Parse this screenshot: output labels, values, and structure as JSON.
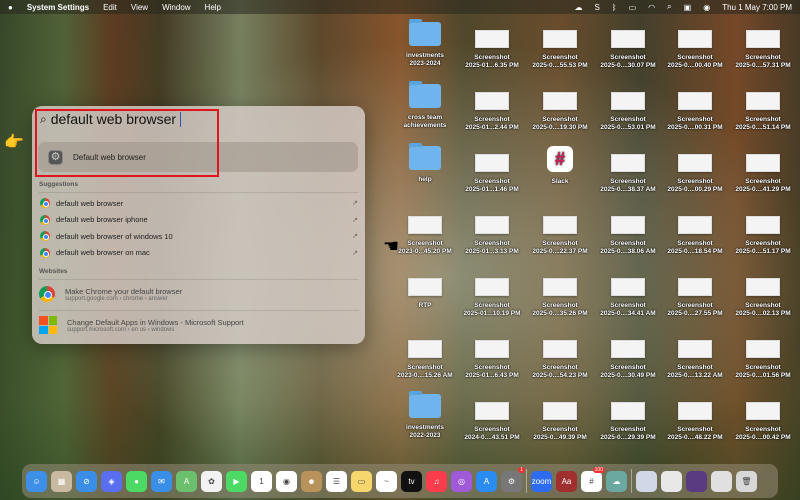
{
  "menubar": {
    "app": "System Settings",
    "items": [
      "Edit",
      "View",
      "Window",
      "Help"
    ],
    "status_icons": [
      "creative-cloud-icon",
      "s-icon",
      "bluetooth-icon",
      "battery-icon",
      "wifi-icon",
      "search-icon",
      "control-center-icon",
      "siri-icon"
    ],
    "clock": "Thu 1 May  7:00 PM"
  },
  "spotlight": {
    "query": "default web browser",
    "top_hit": "Default web browser",
    "suggestions_label": "Suggestions",
    "suggestions": [
      "default web browser",
      "default web browser iphone",
      "default web browser of windows 10",
      "default web browser on mac"
    ],
    "websites_label": "Websites",
    "websites": [
      {
        "title": "Make Chrome your default browser",
        "url": "support.google.com › chrome › answer"
      },
      {
        "title": "Change Default Apps in Windows - Microsoft Support",
        "url": "support.microsoft.com › en us › windows"
      }
    ],
    "highlight_color": "#e0141c"
  },
  "desktop": [
    [
      [
        "folder",
        "investments",
        "2023-2024"
      ],
      [
        "shot",
        "Screenshot",
        "2025-01...6.35 PM"
      ],
      [
        "shot",
        "Screenshot",
        "2025-0....55.53 PM"
      ],
      [
        "shot",
        "Screenshot",
        "2025-0....30.07 PM"
      ],
      [
        "shot",
        "Screenshot",
        "2025-0....00.40 PM"
      ],
      [
        "shot",
        "Screenshot",
        "2025-0....57.31 PM"
      ]
    ],
    [
      [
        "folder",
        "cross team",
        "achievements"
      ],
      [
        "shot",
        "Screenshot",
        "2025-01...2.44 PM"
      ],
      [
        "shot",
        "Screenshot",
        "2025-0....19.30 PM"
      ],
      [
        "shot",
        "Screenshot",
        "2025-0....53.01 PM"
      ],
      [
        "shot",
        "Screenshot",
        "2025-0....00.31 PM"
      ],
      [
        "shot",
        "Screenshot",
        "2025-0....51.14 PM"
      ]
    ],
    [
      [
        "folder",
        "help",
        ""
      ],
      [
        "shot",
        "Screenshot",
        "2025-01...1.46 PM"
      ],
      [
        "slack",
        "Slack",
        ""
      ],
      [
        "shot",
        "Screenshot",
        "2025-0....38.37 AM"
      ],
      [
        "shot",
        "Screenshot",
        "2025-0....00.29 PM"
      ],
      [
        "shot",
        "Screenshot",
        "2025-0....41.29 PM"
      ]
    ],
    [
      [
        "shot",
        "Screenshot",
        "2023-0...45.20 PM"
      ],
      [
        "shot",
        "Screenshot",
        "2025-01...3.13 PM"
      ],
      [
        "shot",
        "Screenshot",
        "2025-0....22.37 PM"
      ],
      [
        "shot",
        "Screenshot",
        "2025-0....38.06 AM"
      ],
      [
        "shot",
        "Screenshot",
        "2025-0....18.54 PM"
      ],
      [
        "shot",
        "Screenshot",
        "2025-0....51.17 PM"
      ]
    ],
    [
      [
        "shot",
        "RTP",
        ""
      ],
      [
        "shot",
        "Screenshot",
        "2025-01...10.19 PM"
      ],
      [
        "shot",
        "Screenshot",
        "2025-0....35.26 PM"
      ],
      [
        "shot",
        "Screenshot",
        "2025-0....34.41 AM"
      ],
      [
        "shot",
        "Screenshot",
        "2025-0....27.55 PM"
      ],
      [
        "shot",
        "Screenshot",
        "2025-0....02.13 PM"
      ]
    ],
    [
      [
        "shot",
        "Screenshot",
        "2023-0....15.26 AM"
      ],
      [
        "shot",
        "Screenshot",
        "2025-01...6.43 PM"
      ],
      [
        "shot",
        "Screenshot",
        "2025-0....54.23 PM"
      ],
      [
        "shot",
        "Screenshot",
        "2025-0....30.49 PM"
      ],
      [
        "shot",
        "Screenshot",
        "2025-0....13.22 AM"
      ],
      [
        "shot",
        "Screenshot",
        "2025-0....01.56 PM"
      ]
    ],
    [
      [
        "folder",
        "investments",
        "2022-2023"
      ],
      [
        "shot",
        "Screenshot",
        "2024-0....43.51 PM"
      ],
      [
        "shot",
        "Screenshot",
        "2025-0...49.39 PM"
      ],
      [
        "shot",
        "Screenshot",
        "2025-0....29.39 PM"
      ],
      [
        "shot",
        "Screenshot",
        "2025-0....48.22 PM"
      ],
      [
        "shot",
        "Screenshot",
        "2025-0....00.42 PM"
      ]
    ]
  ],
  "dock": [
    {
      "name": "finder",
      "color": "#3d8fe8",
      "glyph": "☺"
    },
    {
      "name": "launchpad",
      "color": "#c9b9a0",
      "glyph": "▦"
    },
    {
      "name": "safari",
      "color": "#3a8ee6",
      "glyph": "⊘"
    },
    {
      "name": "copilot",
      "color": "#5a6ef0",
      "glyph": "◈"
    },
    {
      "name": "messages",
      "color": "#4cd964",
      "glyph": "●"
    },
    {
      "name": "mail",
      "color": "#3a8ee6",
      "glyph": "✉"
    },
    {
      "name": "maps",
      "color": "#6cbf6c",
      "glyph": "A"
    },
    {
      "name": "photos",
      "color": "#f2f2f2",
      "glyph": "✿"
    },
    {
      "name": "facetime",
      "color": "#4cd964",
      "glyph": "▶"
    },
    {
      "name": "calendar",
      "color": "#ffffff",
      "glyph": "1"
    },
    {
      "name": "chrome",
      "color": "#ffffff",
      "glyph": "◉"
    },
    {
      "name": "contacts",
      "color": "#b8925a",
      "glyph": "☻"
    },
    {
      "name": "reminders",
      "color": "#ffffff",
      "glyph": "☰"
    },
    {
      "name": "notes",
      "color": "#f5d76e",
      "glyph": "▭"
    },
    {
      "name": "freeform",
      "color": "#ffffff",
      "glyph": "~"
    },
    {
      "name": "tv",
      "color": "#111111",
      "glyph": "tv"
    },
    {
      "name": "music",
      "color": "#fa3c4c",
      "glyph": "♫"
    },
    {
      "name": "podcasts",
      "color": "#a05ad8",
      "glyph": "◎"
    },
    {
      "name": "app-store",
      "color": "#2a8cf0",
      "glyph": "A"
    },
    {
      "name": "system-settings",
      "color": "#777777",
      "glyph": "⚙",
      "badge": "1"
    },
    {
      "sep": true
    },
    {
      "name": "zoom",
      "color": "#2d6cf0",
      "glyph": "zoom"
    },
    {
      "name": "dictionary",
      "color": "#a03030",
      "glyph": "Aa"
    },
    {
      "name": "slack",
      "color": "#ffffff",
      "glyph": "#",
      "badge": "100"
    },
    {
      "name": "cloud-app",
      "color": "#6aa8a0",
      "glyph": "☁"
    },
    {
      "sep": true
    },
    {
      "name": "window-1",
      "color": "#d0d8e8",
      "glyph": ""
    },
    {
      "name": "window-2",
      "color": "#e8e8e8",
      "glyph": ""
    },
    {
      "name": "window-3",
      "color": "#5a3a80",
      "glyph": ""
    },
    {
      "name": "window-4",
      "color": "#e0e0e0",
      "glyph": ""
    },
    {
      "name": "trash",
      "color": "#d8d8d8",
      "glyph": "🗑"
    }
  ]
}
